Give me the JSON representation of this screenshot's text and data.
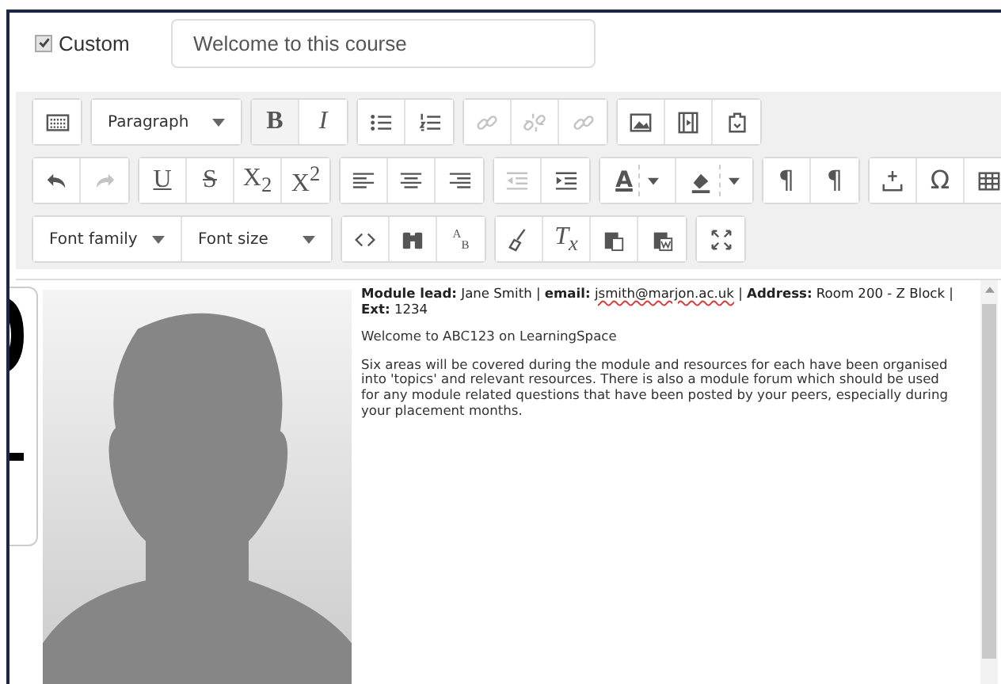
{
  "custom": {
    "label": "Custom",
    "checked": true,
    "value": "Welcome to this course"
  },
  "toolbar": [
    [
      [
        {
          "kind": "icon",
          "disabled": false
        }
      ],
      [
        {
          "kind": "select",
          "label": "Paragraph"
        }
      ],
      [
        {
          "kind": "glyph",
          "text": "B",
          "disabled": false
        },
        {
          "kind": "glyph",
          "text": "I",
          "disabled": false
        }
      ],
      [
        {
          "kind": "icon",
          "disabled": false
        },
        {
          "kind": "icon",
          "disabled": false
        }
      ],
      [
        {
          "kind": "icon",
          "disabled": true
        },
        {
          "kind": "icon",
          "disabled": true
        },
        {
          "kind": "icon",
          "disabled": true
        }
      ],
      [
        {
          "kind": "icon",
          "disabled": false
        },
        {
          "kind": "icon",
          "disabled": false
        },
        {
          "kind": "icon",
          "disabled": false
        }
      ]
    ],
    [
      [
        {
          "kind": "icon",
          "disabled": false
        },
        {
          "kind": "icon",
          "disabled": true
        }
      ],
      [
        {
          "kind": "glyph",
          "text": "U",
          "disabled": false
        },
        {
          "kind": "glyph",
          "text": "S",
          "disabled": false
        },
        {
          "kind": "glyph",
          "text": "X$_{2}$",
          "disabled": false
        },
        {
          "kind": "glyph",
          "text": "X$^{2}$",
          "disabled": false
        }
      ],
      [
        {
          "kind": "icon",
          "disabled": false
        },
        {
          "kind": "icon",
          "disabled": false
        },
        {
          "kind": "icon",
          "disabled": false
        }
      ],
      [
        {
          "kind": "icon",
          "disabled": true
        },
        {
          "kind": "icon",
          "disabled": false
        }
      ],
      [
        {
          "kind": "glyph",
          "text": "A",
          "disabled": false,
          "dropdown": true
        },
        {
          "kind": "icon",
          "disabled": false,
          "dropdown": true
        }
      ],
      [
        {
          "kind": "glyph",
          "text": "¶",
          "disabled": false
        },
        {
          "kind": "glyph",
          "text": "¶",
          "disabled": false
        }
      ],
      [
        {
          "kind": "icon",
          "disabled": false
        },
        {
          "kind": "glyph",
          "text": "Ω",
          "disabled": false
        },
        {
          "kind": "icon",
          "disabled": false
        }
      ]
    ],
    [
      [
        {
          "kind": "select",
          "label": "Font family"
        },
        {
          "kind": "select",
          "label": "Font size"
        }
      ],
      [
        {
          "kind": "icon",
          "disabled": false
        },
        {
          "kind": "icon",
          "disabled": false
        },
        {
          "kind": "glyph",
          "text": "$^{A}$$_{B}$",
          "disabled": false
        }
      ],
      [
        {
          "kind": "icon",
          "disabled": false
        },
        {
          "kind": "glyph",
          "text": "T$_{x}$",
          "disabled": false
        },
        {
          "kind": "icon",
          "disabled": false
        },
        {
          "kind": "icon",
          "disabled": false
        }
      ],
      [
        {
          "kind": "icon",
          "disabled": false
        }
      ]
    ]
  ],
  "editor": {
    "picture": {
      "kind": "picture"
    },
    "header": [
      {
        "text": "**Module lead:** Jane Smith | **email:** ",
        "misspelled": false
      },
      {
        "text": "jsmith@marjon.ac.uk",
        "misspelled": true
      },
      {
        "text": " | **Address:** Room 200 - Z Block | **Ext:** 1234",
        "misspelled": false
      }
    ],
    "paragraphs": [
      "Welcome to ABC123 on LearningSpace",
      "Six areas will be covered during the module and resources for each have been organised into 'topics' and relevant resources.  There is also a module forum which should be used for any module related questions that have been posted by your peers, especially during your placement months."
    ]
  }
}
